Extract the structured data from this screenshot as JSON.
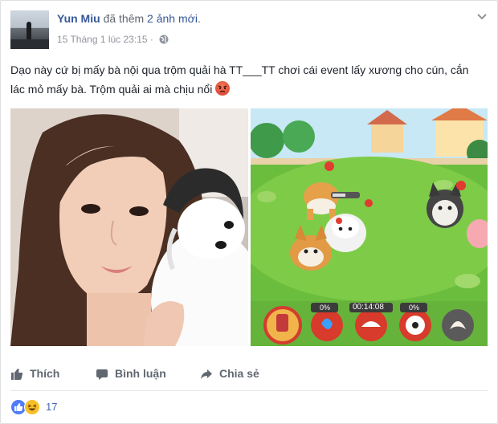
{
  "post": {
    "author": "Yun Miu",
    "action_text": "đã thêm",
    "action_highlight": "2 ảnh mới",
    "action_end": ".",
    "timestamp": "15 Tháng 1 lúc 23:15",
    "privacy_separator": "·",
    "body_text": "Dạo này cứ bị mấy bà nội qua trộm quải hà TT___TT chơi cái event lấy xương cho cún, cắn lác mỏ mấy bà. Trộm quải ai mà chịu nổi",
    "photos": [
      {
        "kind": "selfie-with-puppy"
      },
      {
        "kind": "game-screenshot",
        "hud": {
          "badge_1": "0%",
          "timer": "00:14:08",
          "badge_2": "0%"
        }
      }
    ]
  },
  "actions": {
    "like_label": "Thích",
    "comment_label": "Bình luận",
    "share_label": "Chia sẻ"
  },
  "reactions": {
    "icons": [
      "like-reaction-icon",
      "haha-reaction-icon"
    ],
    "count": "17"
  },
  "colors": {
    "link_blue": "#365899",
    "meta_grey": "#90949c",
    "text": "#1d2129",
    "like_blue": "#4f7cf7",
    "haha_yellow": "#f7c02a",
    "border": "#dddfe2"
  }
}
